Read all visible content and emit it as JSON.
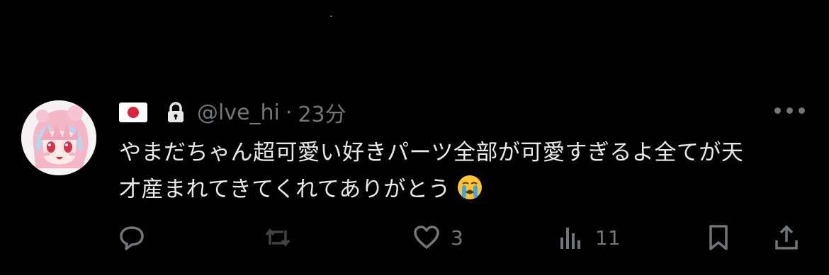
{
  "tweet": {
    "flag_emoji": "🇯🇵",
    "handle": "@lve_hi",
    "separator": "·",
    "time": "23分",
    "text": "やまだちゃん超可愛い好きパーツ全部が可愛すぎるよ全てが天才産まれてきてくれてありがとう",
    "emoji_icon": "loudly-crying-face-icon"
  },
  "actions": {
    "like_count": "3",
    "views_count": "11"
  },
  "colors": {
    "background": "#000000",
    "text": "#e7e9ea",
    "secondary": "#71767b"
  }
}
